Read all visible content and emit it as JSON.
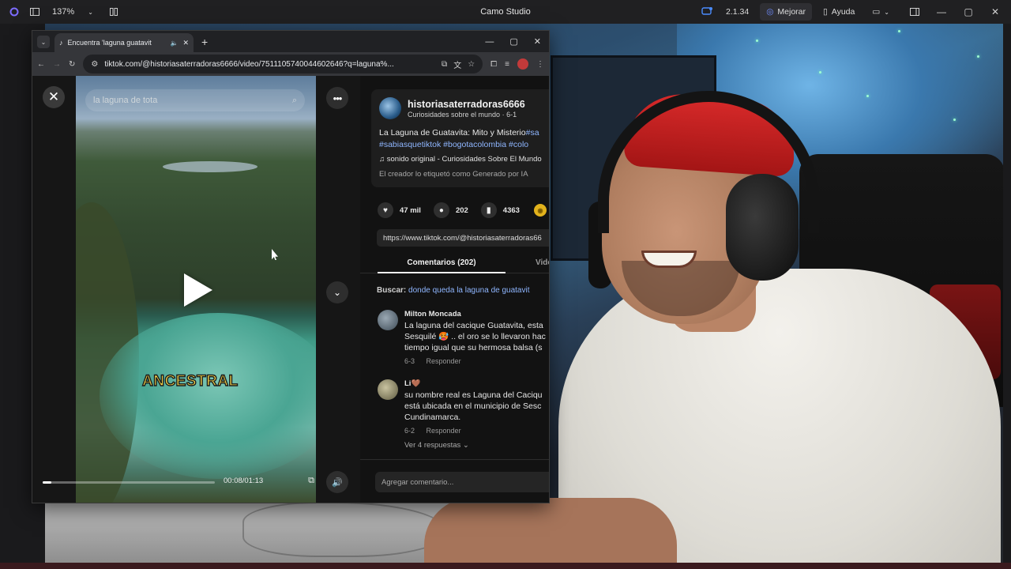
{
  "app": {
    "zoom": "137%",
    "title": "Camo Studio",
    "version": "2.1.34",
    "improve_label": "Mejorar",
    "help_label": "Ayuda"
  },
  "browser": {
    "tab_title": "Encuentra 'laguna guatavit",
    "url": "tiktok.com/@historiasaterradoras6666/video/7511105740044602646?q=laguna%..."
  },
  "video": {
    "search_text": "la laguna de tota",
    "caption": "ANCESTRAL",
    "time": "00:08/01:13",
    "progress": 0.05
  },
  "post": {
    "author": "historiasaterradoras6666",
    "author_sub": "Curiosidades sobre el mundo · 6-1",
    "desc_line1": "La Laguna de Guatavita: Mito y Misterio",
    "desc_tag1": "#sa",
    "desc_line2_tags": "#sabiasquetiktok #bogotacolombia #colo",
    "sound": "sonido original - Curiosidades Sobre El Mundo",
    "ai_label": "El creador lo etiquetó como Generado por IA",
    "likes": "47 mil",
    "comments": "202",
    "saves": "4363",
    "share_link": "https://www.tiktok.com/@historiasaterradoras66"
  },
  "tabs": {
    "comments": "Comentarios (202)",
    "videos": "Vide"
  },
  "search_hint": {
    "label": "Buscar:",
    "query": "donde queda la laguna de guatavit"
  },
  "comments": [
    {
      "name": "Milton Moncada",
      "line1": "La laguna del cacique Guatavita, esta",
      "line2": "Sesquilé 🥵 .. el oro se lo llevaron hac",
      "line3": "tiempo igual que su hermosa balsa (s",
      "date": "6-3",
      "reply": "Responder",
      "avatar_color": "#6a7a86"
    },
    {
      "name": "Li🤎",
      "line1": "su nombre real es Laguna del Caciqu",
      "line2": "está ubicada en el municipio de Sesc",
      "line3": "Cundinamarca.",
      "date": "6-2",
      "reply": "Responder",
      "more": "Ver 4 respuestas ⌄",
      "avatar_color": "#8a8468"
    }
  ],
  "add_comment_placeholder": "Agregar comentario..."
}
